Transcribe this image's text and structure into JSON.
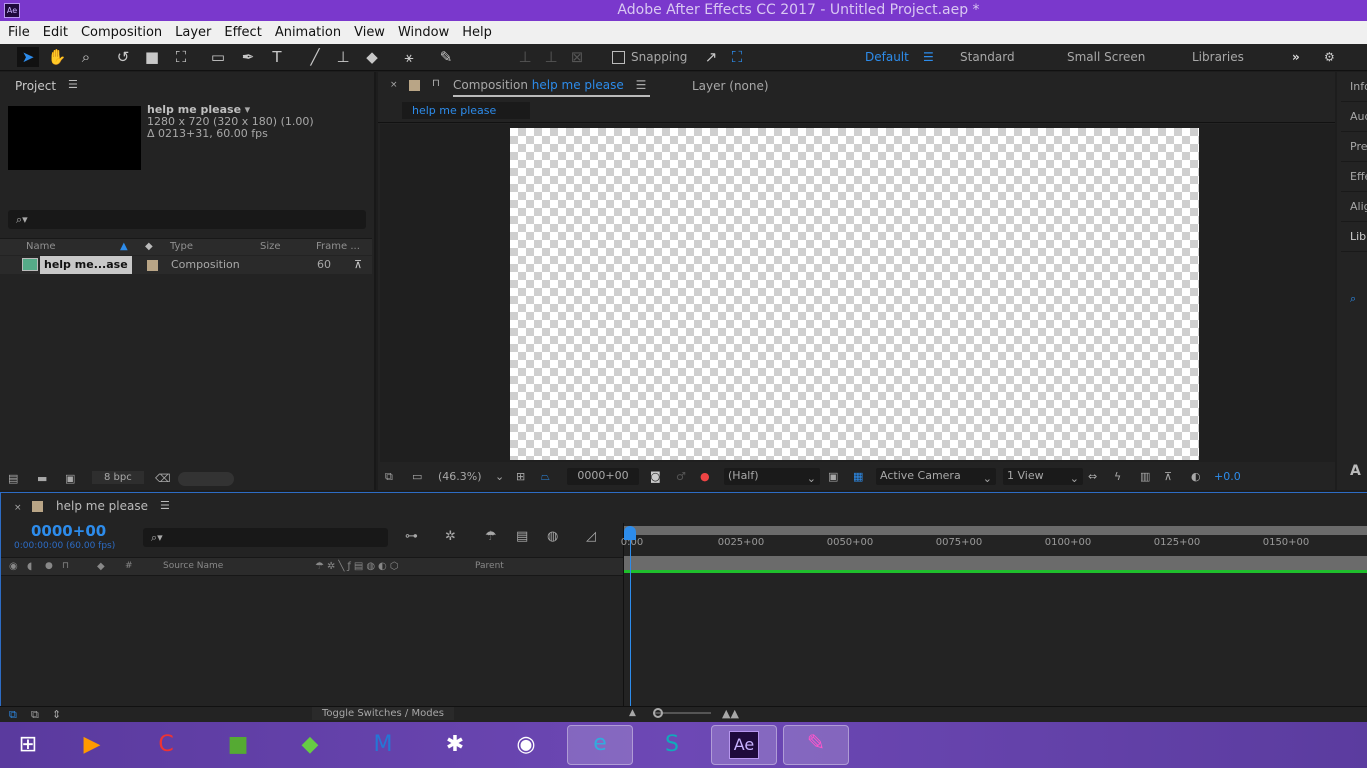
{
  "app": {
    "logo": "Ae",
    "title": "Adobe After Effects CC 2017 - Untitled Project.aep *"
  },
  "menu": [
    "File",
    "Edit",
    "Composition",
    "Layer",
    "Effect",
    "Animation",
    "View",
    "Window",
    "Help"
  ],
  "toolbar": {
    "tools": [
      "selection-tool",
      "hand-tool",
      "zoom-tool",
      "rotate-tool",
      "camera-tool",
      "pan-behind-tool",
      "rectangle-tool",
      "pen-tool",
      "type-tool",
      "brush-tool",
      "clone-stamp-tool",
      "eraser-tool",
      "roto-brush-tool",
      "puppet-pin-tool"
    ],
    "snapping": "Snapping",
    "workspaces": [
      "Default",
      "Standard",
      "Small Screen",
      "Libraries"
    ],
    "active_workspace": "Default",
    "more": "»"
  },
  "project": {
    "title": "Project",
    "comp_name": "help me please",
    "comp_info1": "1280 x 720  (320 x 180) (1.00)",
    "comp_info2": "Δ 0213+31, 60.00 fps",
    "search_placeholder": "",
    "columns": [
      "Name",
      "Type",
      "Size",
      "Frame ..."
    ],
    "items": [
      {
        "name": "help me...ase",
        "type": "Composition",
        "size": "",
        "frame": "60",
        "label_color": "#b9a586"
      }
    ],
    "bpc": "8 bpc"
  },
  "comp": {
    "tab_prefix": "Composition",
    "tab_name": "help me please",
    "layer_tab": "Layer (none)",
    "breadcrumb": "help me please",
    "zoom": "(46.3%)",
    "timecode": "0000+00",
    "resolution": "(Half)",
    "camera": "Active Camera",
    "views": "1 View",
    "exposure": "+0.0"
  },
  "right_panels": [
    "Info",
    "Audio",
    "Preview",
    "Effects & Presets",
    "Align",
    "Libraries"
  ],
  "right_panel_bottom": "A",
  "timeline": {
    "tab": "help me please",
    "timecode": "0000+00",
    "timecode_sub": "0:00:00:00 (60.00 fps)",
    "columns": {
      "num": "#",
      "source": "Source Name",
      "parent": "Parent"
    },
    "ruler": [
      "0:00",
      "0025+00",
      "0050+00",
      "0075+00",
      "0100+00",
      "0125+00",
      "0150+00"
    ],
    "toggle": "Toggle Switches / Modes"
  },
  "taskbar": [
    "windows-start",
    "media-player",
    "ccleaner",
    "minecraft",
    "sims",
    "malwarebytes",
    "bug-app",
    "steam",
    "internet-explorer",
    "skype",
    "after-effects",
    "paint"
  ],
  "colors": {
    "accent": "#2d8ceb",
    "titlebar": "#7a38cc",
    "work_area": "#1fbe2c"
  }
}
